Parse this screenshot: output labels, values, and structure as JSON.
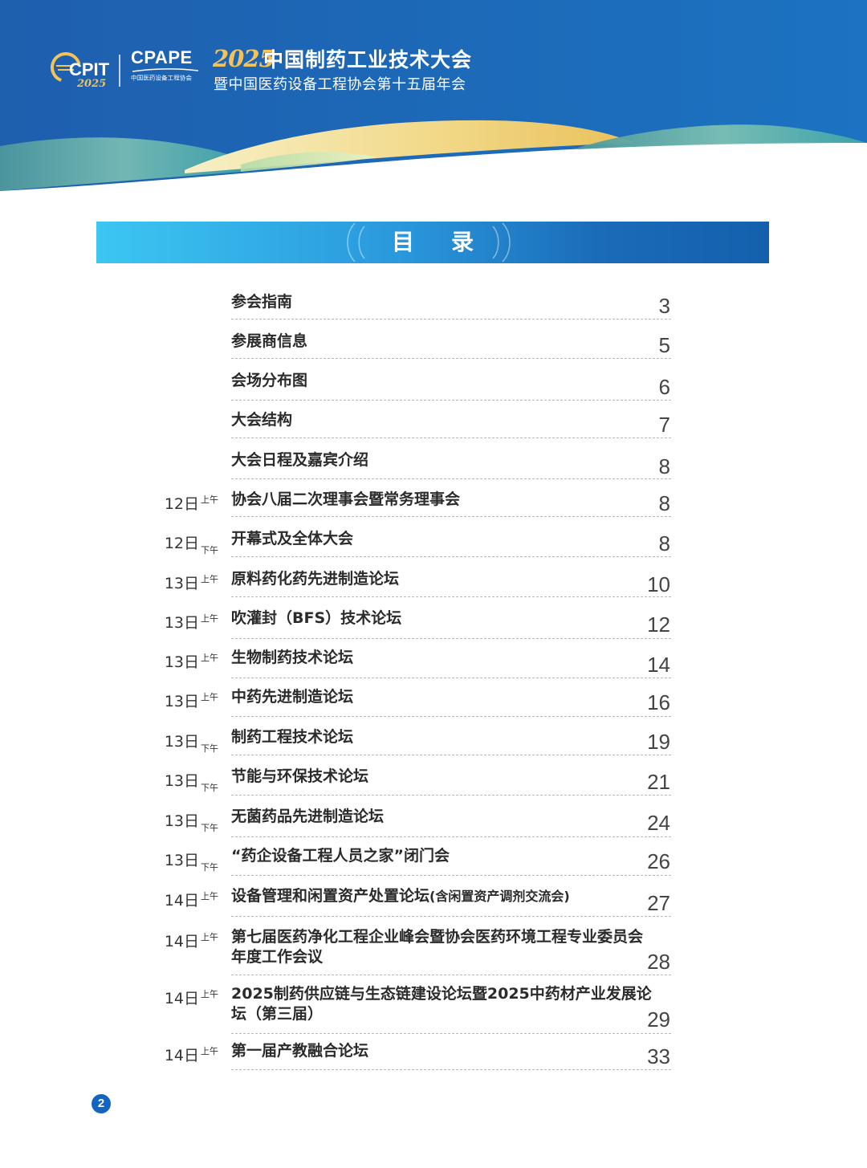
{
  "header": {
    "cpit_logo_text": "CPIT",
    "cpit_logo_year": "2025",
    "cpape_name": "CPAPE",
    "cpape_sub": "中国医药设备工程协会",
    "title_year": "2025",
    "title_main": "中国制药工业技术大会",
    "title_sub": "暨中国医药设备工程协会第十五届年会",
    "colors": {
      "navy": "#1c5aa8",
      "gold": "#f2c35a",
      "teal": "#3aa5a3"
    }
  },
  "toc": {
    "title": "目录",
    "rows": [
      {
        "date": "",
        "ampm": "",
        "title": "参会指南",
        "page": "3"
      },
      {
        "date": "",
        "ampm": "",
        "title": "参展商信息",
        "page": "5"
      },
      {
        "date": "",
        "ampm": "",
        "title": "会场分布图",
        "page": "6"
      },
      {
        "date": "",
        "ampm": "",
        "title": "大会结构",
        "page": "7"
      },
      {
        "date": "",
        "ampm": "",
        "title": "大会日程及嘉宾介绍",
        "page": "8"
      },
      {
        "date": "12日",
        "ampm": "上午",
        "title": "协会八届二次理事会暨常务理事会",
        "page": "8"
      },
      {
        "date": "12日",
        "ampm": "下午",
        "title": "开幕式及全体大会",
        "page": "8"
      },
      {
        "date": "13日",
        "ampm": "上午",
        "title": "原料药化药先进制造论坛",
        "page": "10"
      },
      {
        "date": "13日",
        "ampm": "上午",
        "title": "吹灌封（BFS）技术论坛",
        "page": "12"
      },
      {
        "date": "13日",
        "ampm": "上午",
        "title": "生物制药技术论坛",
        "page": "14"
      },
      {
        "date": "13日",
        "ampm": "上午",
        "title": "中药先进制造论坛",
        "page": "16"
      },
      {
        "date": "13日",
        "ampm": "下午",
        "title": "制药工程技术论坛",
        "page": "19"
      },
      {
        "date": "13日",
        "ampm": "下午",
        "title": "节能与环保技术论坛",
        "page": "21"
      },
      {
        "date": "13日",
        "ampm": "下午",
        "title": "无菌药品先进制造论坛",
        "page": "24"
      },
      {
        "date": "13日",
        "ampm": "下午",
        "title": "“药企设备工程人员之家”闭门会",
        "page": "26"
      },
      {
        "date": "14日",
        "ampm": "上午",
        "title": "设备管理和闲置资产处置论坛",
        "note": "(含闲置资产调剂交流会)",
        "page": "27"
      },
      {
        "date": "14日",
        "ampm": "上午",
        "title": "第七届医药净化工程企业峰会暨协会医药环境工程专业委员会年度工作会议",
        "page": "28"
      },
      {
        "date": "14日",
        "ampm": "上午",
        "title": "2025制药供应链与生态链建设论坛暨2025中药材产业发展论坛（第三届）",
        "page": "29"
      },
      {
        "date": "14日",
        "ampm": "上午",
        "title": "第一届产教融合论坛",
        "page": "33"
      }
    ]
  },
  "footer": {
    "page_number": "2"
  }
}
